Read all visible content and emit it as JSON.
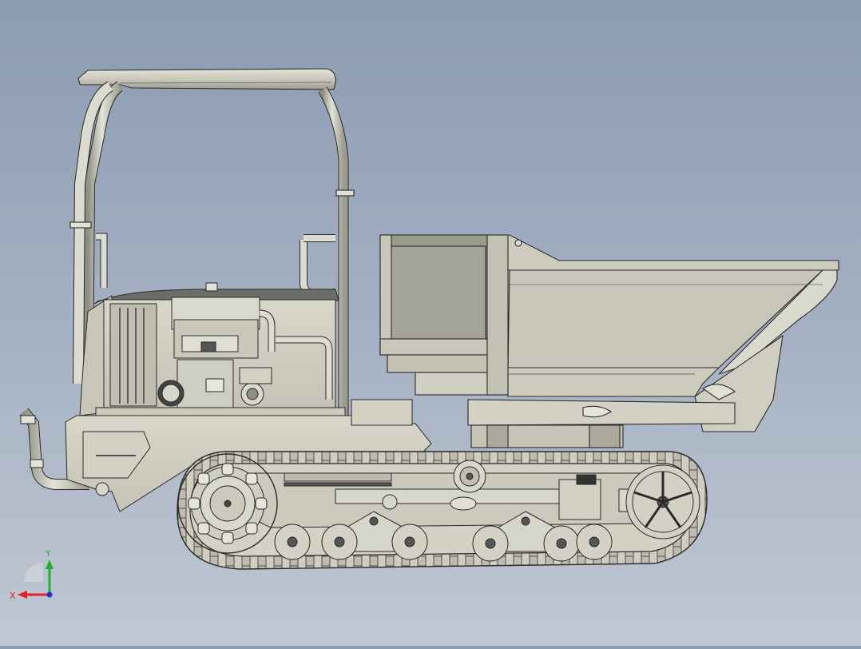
{
  "triad": {
    "x_label": "X",
    "y_label": "Y",
    "x_color": "#e8202a",
    "y_color": "#1fb32c",
    "z_color": "#2233cc"
  },
  "colors": {
    "background_top": "#8b9bb1",
    "background_bottom": "#bfc7d3",
    "body_fill": "#d4d3c5",
    "body_dark": "#a9a89a",
    "outline": "#2a2a2a"
  }
}
